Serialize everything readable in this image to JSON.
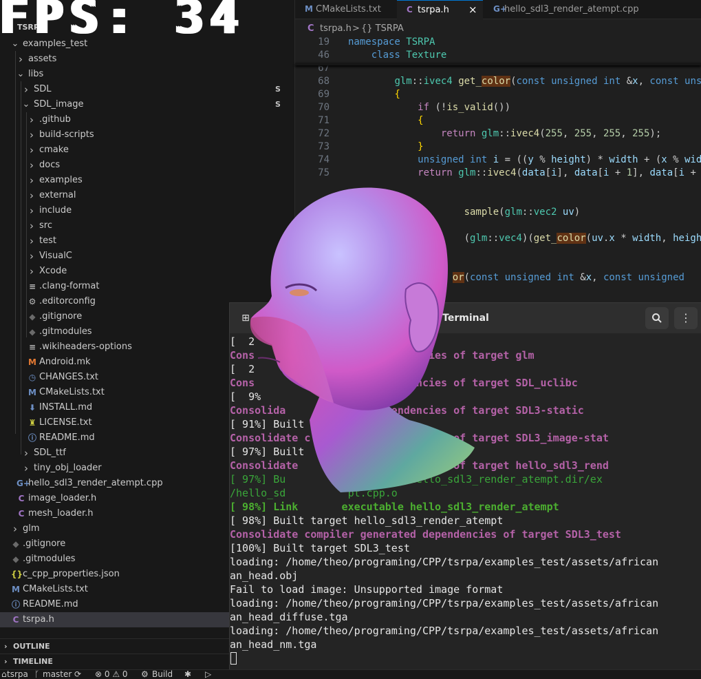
{
  "fps_overlay": "FPS: 34",
  "explorer": {
    "workspace": "TSRPA",
    "items": [
      {
        "label": "examples_test",
        "kind": "folder",
        "open": true
      },
      {
        "label": "assets",
        "kind": "folder",
        "open": false
      },
      {
        "label": "libs",
        "kind": "folder",
        "open": true
      },
      {
        "label": "SDL",
        "kind": "folder",
        "open": false,
        "badge": "S"
      },
      {
        "label": "SDL_image",
        "kind": "folder",
        "open": true,
        "badge": "S"
      },
      {
        "label": ".github",
        "kind": "folder",
        "open": false
      },
      {
        "label": "build-scripts",
        "kind": "folder",
        "open": false
      },
      {
        "label": "cmake",
        "kind": "folder",
        "open": false
      },
      {
        "label": "docs",
        "kind": "folder",
        "open": false
      },
      {
        "label": "examples",
        "kind": "folder",
        "open": false
      },
      {
        "label": "external",
        "kind": "folder",
        "open": false
      },
      {
        "label": "include",
        "kind": "folder",
        "open": false
      },
      {
        "label": "src",
        "kind": "folder",
        "open": false
      },
      {
        "label": "test",
        "kind": "folder",
        "open": false
      },
      {
        "label": "VisualC",
        "kind": "folder",
        "open": false
      },
      {
        "label": "Xcode",
        "kind": "folder",
        "open": false
      },
      {
        "label": ".clang-format",
        "kind": "file",
        "icon": "≡",
        "icon_color": "#b8b8b8"
      },
      {
        "label": ".editorconfig",
        "kind": "file",
        "icon": "⚙",
        "icon_color": "#b8b8b8"
      },
      {
        "label": ".gitignore",
        "kind": "file",
        "icon": "◆",
        "icon_color": "#6a6a6a"
      },
      {
        "label": ".gitmodules",
        "kind": "file",
        "icon": "◆",
        "icon_color": "#6a6a6a"
      },
      {
        "label": ".wikiheaders-options",
        "kind": "file",
        "icon": "≡",
        "icon_color": "#b8b8b8"
      },
      {
        "label": "Android.mk",
        "kind": "file",
        "icon": "M",
        "icon_color": "#e37933"
      },
      {
        "label": "CHANGES.txt",
        "kind": "file",
        "icon": "◷",
        "icon_color": "#6d8fc4"
      },
      {
        "label": "CMakeLists.txt",
        "kind": "file",
        "icon": "M",
        "icon_color": "#6d8fc4"
      },
      {
        "label": "INSTALL.md",
        "kind": "file",
        "icon": "⬇",
        "icon_color": "#6d8fc4"
      },
      {
        "label": "LICENSE.txt",
        "kind": "file",
        "icon": "♜",
        "icon_color": "#cbcb41"
      },
      {
        "label": "README.md",
        "kind": "file",
        "icon": "ⓘ",
        "icon_color": "#6d8fc4"
      },
      {
        "label": "SDL_ttf",
        "kind": "folder",
        "open": false
      },
      {
        "label": "tiny_obj_loader",
        "kind": "folder",
        "open": false
      },
      {
        "label": "hello_sdl3_render_atempt.cpp",
        "kind": "file",
        "icon": "G+",
        "icon_color": "#6d8fc4"
      },
      {
        "label": "image_loader.h",
        "kind": "file",
        "icon": "C",
        "icon_color": "#a074c4"
      },
      {
        "label": "mesh_loader.h",
        "kind": "file",
        "icon": "C",
        "icon_color": "#a074c4"
      },
      {
        "label": "glm",
        "kind": "folder",
        "open": false
      },
      {
        "label": ".gitignore",
        "kind": "file",
        "icon": "◆",
        "icon_color": "#6a6a6a"
      },
      {
        "label": ".gitmodules",
        "kind": "file",
        "icon": "◆",
        "icon_color": "#6a6a6a"
      },
      {
        "label": "c_cpp_properties.json",
        "kind": "file",
        "icon": "{}",
        "icon_color": "#cbcb41"
      },
      {
        "label": "CMakeLists.txt",
        "kind": "file",
        "icon": "M",
        "icon_color": "#6d8fc4"
      },
      {
        "label": "README.md",
        "kind": "file",
        "icon": "ⓘ",
        "icon_color": "#6d8fc4"
      },
      {
        "label": "tsrpa.h",
        "kind": "file",
        "icon": "C",
        "icon_color": "#a074c4",
        "selected": true
      }
    ],
    "sections": [
      "OUTLINE",
      "TIMELINE"
    ]
  },
  "statusbar": {
    "repo": "tsrpa",
    "branch": "master",
    "problems": "⊗ 0 ⚠ 0",
    "build": "Build"
  },
  "editor": {
    "tabs": [
      {
        "label": "CMakeLists.txt",
        "icon": "M",
        "icon_color": "#6d8fc4",
        "active": false
      },
      {
        "label": "tsrpa.h",
        "icon": "C",
        "icon_color": "#a074c4",
        "active": true,
        "close": "×"
      },
      {
        "label": "hello_sdl3_render_atempt.cpp",
        "icon": "G+",
        "icon_color": "#6d8fc4",
        "active": false
      }
    ],
    "breadcrumb": {
      "file": "tsrpa.h",
      "sep": ">",
      "symbol": "{} TSRPA"
    },
    "sticky_lines": [
      {
        "ln": "19",
        "html": "<span class=\"kw\">namespace</span> <span class=\"ty\">TSRPA</span>"
      },
      {
        "ln": "46",
        "html": "    <span class=\"kw\">class</span> <span class=\"ty\">Texture</span>"
      }
    ],
    "code_lines": [
      {
        "ln": "67",
        "html": ""
      },
      {
        "ln": "68",
        "html": "        <span class=\"ty\">glm</span>::<span class=\"ty\">ivec4</span> <span class=\"fn\">get_<span class=\"hl\">color</span></span>(<span class=\"kw\">const</span> <span class=\"kw\">unsigned</span> <span class=\"kw\">int</span> &amp;<span class=\"vr\">x</span>, <span class=\"kw\">const</span> <span class=\"kw\">uns</span>"
      },
      {
        "ln": "69",
        "html": "        <span class=\"pn\">{</span>"
      },
      {
        "ln": "70",
        "html": "            <span class=\"kw2\">if</span> (!<span class=\"fn\">is_valid</span>())"
      },
      {
        "ln": "71",
        "html": "            <span class=\"pn\">{</span>"
      },
      {
        "ln": "72",
        "html": "                <span class=\"kw2\">return</span> <span class=\"ty\">glm</span>::<span class=\"fn\">ivec4</span>(<span class=\"nm\">255</span>, <span class=\"nm\">255</span>, <span class=\"nm\">255</span>, <span class=\"nm\">255</span>);"
      },
      {
        "ln": "73",
        "html": "            <span class=\"pn\">}</span>"
      },
      {
        "ln": "74",
        "html": "            <span class=\"kw\">unsigned</span> <span class=\"kw\">int</span> <span class=\"vr\">i</span> = ((<span class=\"vr\">y</span> % <span class=\"vr\">height</span>) * <span class=\"vr\">width</span> + (<span class=\"vr\">x</span> % <span class=\"vr\">wid</span>"
      },
      {
        "ln": "75",
        "html": "            <span class=\"kw2\">return</span> <span class=\"ty\">glm</span>::<span class=\"fn\">ivec4</span>(<span class=\"vr\">data</span>[<span class=\"vr\">i</span>], <span class=\"vr\">data</span>[<span class=\"vr\">i</span> + <span class=\"nm\">1</span>], <span class=\"vr\">data</span>[<span class=\"vr\">i</span> + "
      },
      {
        "ln": "",
        "html": ""
      },
      {
        "ln": "",
        "html": ""
      },
      {
        "ln": "",
        "html": "                    <span class=\"fn\">sample</span>(<span class=\"ty\">glm</span>::<span class=\"ty\">vec2</span> <span class=\"vr\">uv</span>)"
      },
      {
        "ln": "",
        "html": ""
      },
      {
        "ln": "",
        "html": "                    (<span class=\"ty\">glm</span>::<span class=\"ty\">vec4</span>)(<span class=\"fn\">get_<span class=\"hl\">color</span></span>(<span class=\"vr\">uv</span>.<span class=\"vr\">x</span> * <span class=\"vr\">width</span>, <span class=\"vr\">height</span>"
      },
      {
        "ln": "",
        "html": ""
      },
      {
        "ln": "",
        "html": ""
      },
      {
        "ln": "",
        "html": "                  <span class=\"hl fn\">or</span>(<span class=\"kw\">const</span> <span class=\"kw\">unsigned</span> <span class=\"kw\">int</span> &amp;<span class=\"vr\">x</span>, <span class=\"kw\">const</span> <span class=\"kw\">unsigned</span> "
      }
    ]
  },
  "terminal": {
    "title": "Terminal",
    "lines": [
      {
        "cls": "t-wht",
        "text": "[  2                  tatic"
      },
      {
        "cls": "t-mag",
        "text": "Cons                   dependencies of target glm"
      },
      {
        "cls": "t-wht",
        "text": "[  2"
      },
      {
        "cls": "t-mag",
        "text": "Cons                   dependencies of target SDL_uclibc"
      },
      {
        "cls": "t-wht",
        "text": "[  9%"
      },
      {
        "cls": "t-mag",
        "text": "Consolida              dependencies of target SDL3-static"
      },
      {
        "cls": "t-wht",
        "text": "[ 91%] Built"
      },
      {
        "cls": "t-mag",
        "text": "Consolidate c          dependencies of target SDL3_image-stat"
      },
      {
        "cls": "t-wht",
        "text": "[ 97%] Built         atic"
      },
      {
        "cls": "t-mag",
        "text": "Consolidate            dependencies of target hello_sdl3_rend"
      },
      {
        "cls": "t-grn",
        "text": "[ 97%] Bu         CMakeFiles/hello_sdl3_render_atempt.dir/ex"
      },
      {
        "cls": "t-grn",
        "text": "/hello_sd          pt.cpp.o"
      },
      {
        "cls": "t-grnb",
        "text": "[ 98%] Link       executable hello_sdl3_render_atempt"
      },
      {
        "cls": "t-wht",
        "text": "[ 98%] Built target hello_sdl3_render_atempt"
      },
      {
        "cls": "t-mag",
        "text": "Consolidate compiler generated dependencies of target SDL3_test"
      },
      {
        "cls": "t-wht",
        "text": "[100%] Built target SDL3_test"
      },
      {
        "cls": "t-wht",
        "text": "loading: /home/theo/programing/CPP/tsrpa/examples_test/assets/african"
      },
      {
        "cls": "t-wht",
        "text": "an_head.obj"
      },
      {
        "cls": "t-wht",
        "text": "Fail to load image: Unsupported image format"
      },
      {
        "cls": "t-wht",
        "text": "loading: /home/theo/programing/CPP/tsrpa/examples_test/assets/african"
      },
      {
        "cls": "t-wht",
        "text": "an_head_diffuse.tga"
      },
      {
        "cls": "t-wht",
        "text": "loading: /home/theo/programing/CPP/tsrpa/examples_test/assets/african"
      },
      {
        "cls": "t-wht",
        "text": "an_head_nm.tga"
      }
    ]
  }
}
